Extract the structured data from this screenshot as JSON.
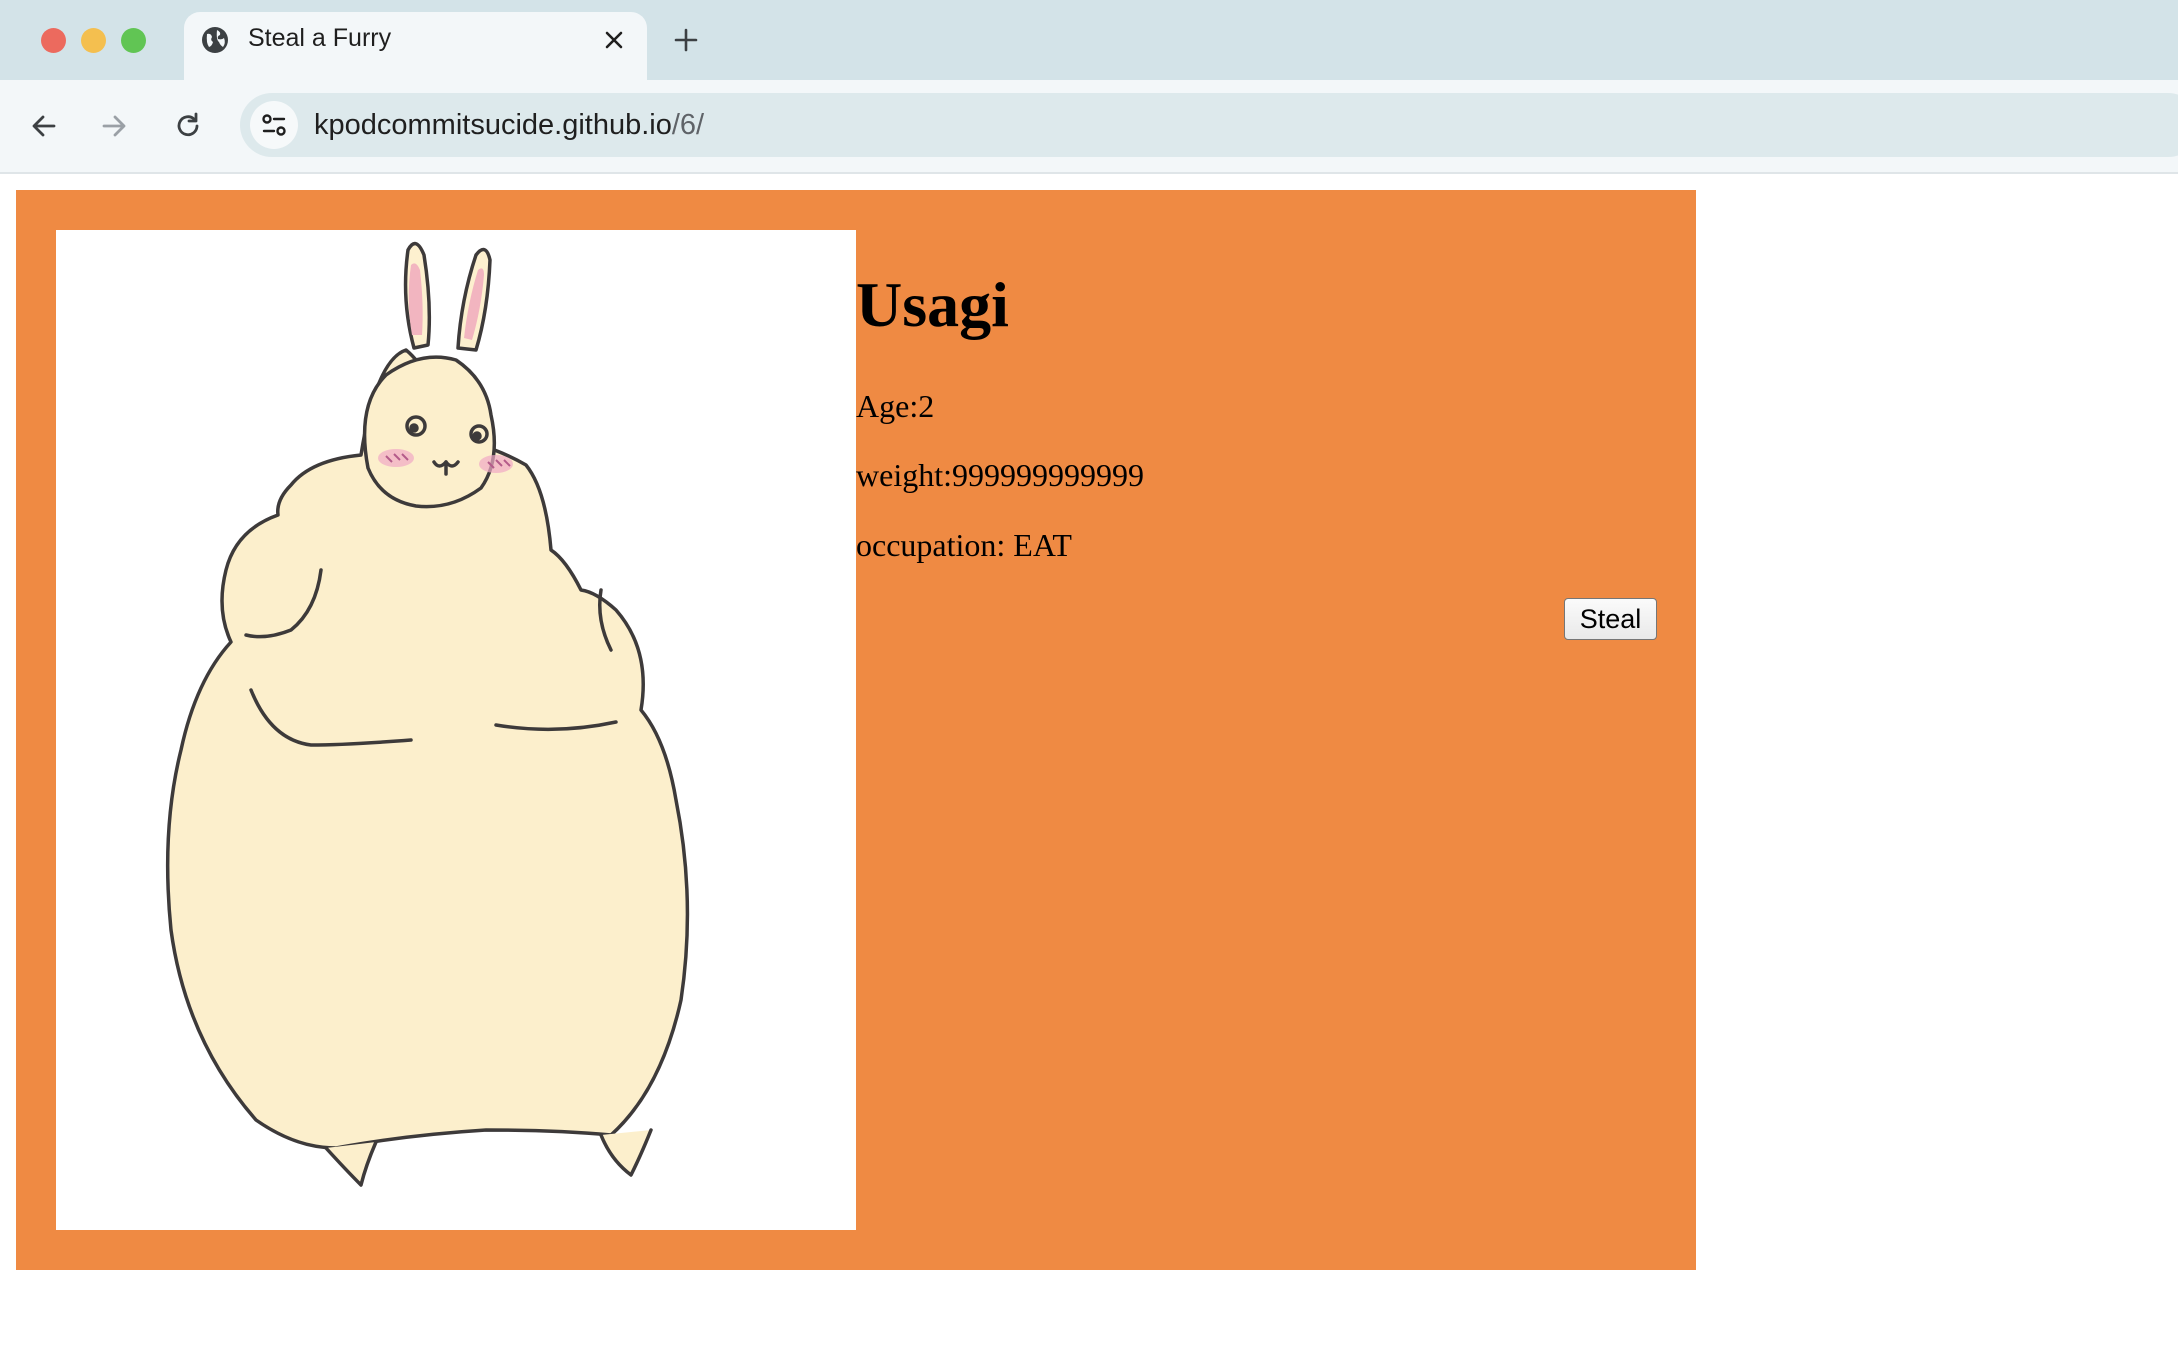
{
  "browser": {
    "tab_title": "Steal a Furry",
    "url_host": "kpodcommitsucide.github.io",
    "url_path": "/6/"
  },
  "icons": {
    "tab": "globe-icon",
    "close": "close-icon",
    "new_tab": "plus-icon",
    "back": "arrow-left-icon",
    "forward": "arrow-right-icon",
    "reload": "reload-icon",
    "site_info": "tune-icon"
  },
  "colors": {
    "card_background": "#ef8a43",
    "tab_strip": "#d3e3e8",
    "toolbar": "#f3f7f9",
    "omnibox": "#dde9ec"
  },
  "profile": {
    "name": "Usagi",
    "age": "Age:2",
    "weight": "weight:999999999999",
    "occupation": "occupation: EAT",
    "steal_label": "Steal"
  }
}
